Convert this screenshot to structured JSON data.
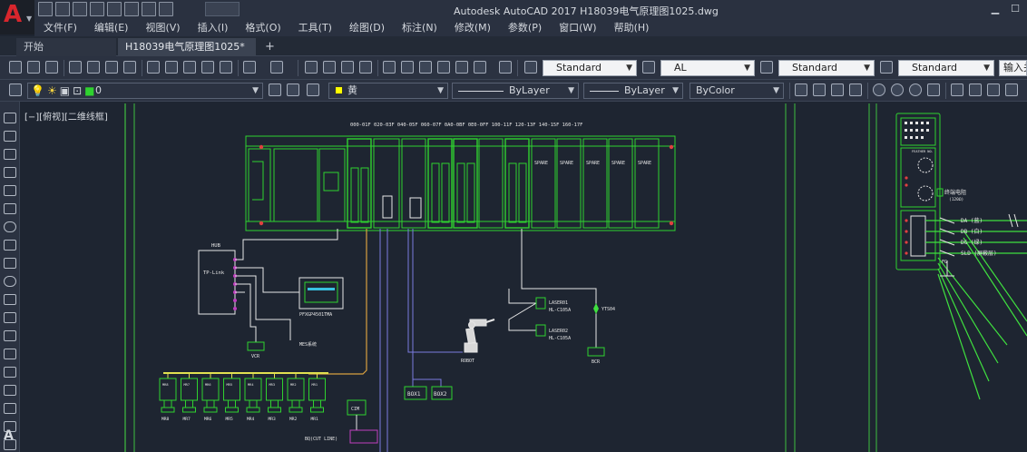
{
  "app": {
    "window_title": "Autodesk AutoCAD 2017    H18039电气原理图1025.dwg",
    "logo_letter": "A"
  },
  "menu": [
    {
      "label": "文件(F)"
    },
    {
      "label": "编辑(E)"
    },
    {
      "label": "视图(V)"
    },
    {
      "label": "插入(I)"
    },
    {
      "label": "格式(O)"
    },
    {
      "label": "工具(T)"
    },
    {
      "label": "绘图(D)"
    },
    {
      "label": "标注(N)"
    },
    {
      "label": "修改(M)"
    },
    {
      "label": "参数(P)"
    },
    {
      "label": "窗口(W)"
    },
    {
      "label": "帮助(H)"
    }
  ],
  "tabs": {
    "start": "开始",
    "drawing": "H18039电气原理图1025*",
    "add": "+"
  },
  "toolbar": {
    "text_style": "Standard",
    "dim_style": "AL",
    "table_style": "Standard",
    "mleader_style": "Standard",
    "input_hint": "输入关"
  },
  "properties": {
    "layer": "0",
    "color": "黄",
    "color_hex": "#ffff00",
    "linetype": "ByLayer",
    "lineweight": "ByLayer",
    "plot_style": "ByColor"
  },
  "viewport": {
    "label": "[−][俯视][二维线框]"
  },
  "drawing": {
    "io_header": "000-01F 020-03F 040-05F 060-07F 0A0-0BF 0E0-0FF 100-11F 120-13F 140-15F 160-17F",
    "spare_label": "SPARE",
    "hub": "HUB",
    "tplink": "TP-Link",
    "hmi_label": "PFXGP4501TMA",
    "vcr": "VCR",
    "mes": "MES系统",
    "cim": "CIM",
    "bq": "BQ(CUT LINE)",
    "laser1_line1": "LASER01",
    "laser1_line2": "HL-C105A",
    "laser2_line1": "LASER02",
    "laser2_line2": "HL-C105A",
    "yts": "YTS04",
    "bcr": "BCR",
    "robot": "ROBOT",
    "box1": "BOX1",
    "box2": "BOX2",
    "servo_tags": [
      "MR8",
      "MR7",
      "MR6",
      "MR5",
      "MR4",
      "MR3",
      "MR2",
      "MR1"
    ],
    "servo_top": [
      "MR8",
      "MR7",
      "MR6",
      "MR5",
      "MR4",
      "MR3",
      "MR2",
      "MR1"
    ],
    "station_label": "FEATHER NO.",
    "terminal_title": "终端电阻",
    "terminal_sub": "(120Ω)",
    "da": "DA (蓝)",
    "db": "DB (白)",
    "dg": "DG (绿)",
    "sld": "SLD (屏蔽层)",
    "fg": "FG"
  },
  "colors": {
    "background": "#1e2531",
    "plc": "#2fd22f",
    "wire_white": "#e6e6e6",
    "wire_orange": "#d8a040",
    "wire_blue": "#7a7ae0",
    "wire_green": "#3fe03f",
    "frame_green": "#3fc03f",
    "bus_yellow": "#e0e050",
    "magenta": "#c040c0"
  }
}
